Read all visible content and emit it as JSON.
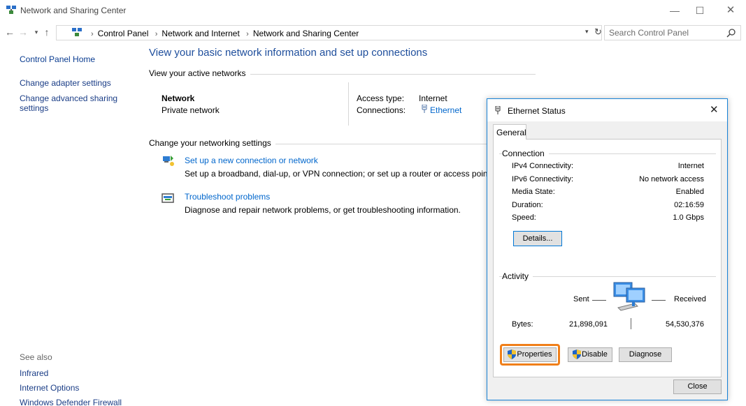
{
  "window": {
    "title": "Network and Sharing Center",
    "minimize_glyph": "—",
    "maximize_glyph": "☐",
    "close_glyph": "✕"
  },
  "nav": {
    "back_glyph": "←",
    "forward_glyph": "→",
    "recent_glyph": "▾",
    "up_glyph": "↑",
    "breadcrumbs": [
      "Control Panel",
      "Network and Internet",
      "Network and Sharing Center"
    ],
    "sep": "›",
    "dropdown_glyph": "▾",
    "refresh_glyph": "↻",
    "search_placeholder": "Search Control Panel"
  },
  "sidebar": {
    "home": "Control Panel Home",
    "links": [
      "Change adapter settings",
      "Change advanced sharing settings"
    ],
    "see_also_heading": "See also",
    "see_also": [
      "Infrared",
      "Internet Options",
      "Windows Defender Firewall"
    ]
  },
  "main": {
    "title": "View your basic network information and set up connections",
    "active_networks_heading": "View your active networks",
    "network_name": "Network",
    "network_category": "Private network",
    "access_type_label": "Access type:",
    "access_type_value": "Internet",
    "connections_label": "Connections:",
    "connections_value": "Ethernet",
    "change_settings_heading": "Change your networking settings",
    "tasks": [
      {
        "link": "Set up a new connection or network",
        "desc": "Set up a broadband, dial-up, or VPN connection; or set up a router or access point.",
        "icon": "network-setup-icon"
      },
      {
        "link": "Troubleshoot problems",
        "desc": "Diagnose and repair network problems, or get troubleshooting information.",
        "icon": "troubleshoot-icon"
      }
    ]
  },
  "dialog": {
    "title": "Ethernet Status",
    "close_glyph": "✕",
    "tab": "General",
    "connection_heading": "Connection",
    "rows": [
      {
        "label": "IPv4 Connectivity:",
        "value": "Internet"
      },
      {
        "label": "IPv6 Connectivity:",
        "value": "No network access"
      },
      {
        "label": "Media State:",
        "value": "Enabled"
      },
      {
        "label": "Duration:",
        "value": "02:16:59"
      },
      {
        "label": "Speed:",
        "value": "1.0 Gbps"
      }
    ],
    "details_button": "Details...",
    "activity_heading": "Activity",
    "sent_label": "Sent",
    "received_label": "Received",
    "bytes_label": "Bytes:",
    "bytes_sent": "21,898,091",
    "bytes_received": "54,530,376",
    "properties_button": "Properties",
    "disable_button": "Disable",
    "diagnose_button": "Diagnose",
    "close_button": "Close"
  },
  "colors": {
    "link": "#0066cc",
    "accent_border": "#1883d7",
    "highlight": "#f07f1a"
  }
}
